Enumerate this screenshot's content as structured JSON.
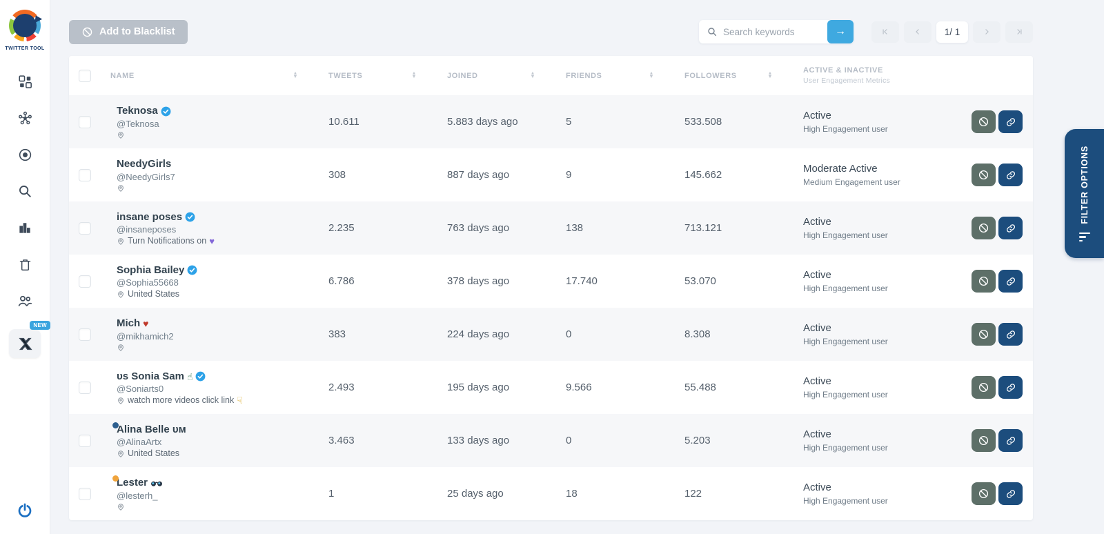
{
  "brand": {
    "title": "TWITTER TOOL"
  },
  "sidebar": {
    "items": [
      {
        "icon": "dashboard-grid-icon"
      },
      {
        "icon": "network-hub-icon"
      },
      {
        "icon": "target-icon"
      },
      {
        "icon": "search-icon"
      },
      {
        "icon": "bar-chart-icon"
      },
      {
        "icon": "trash-icon"
      },
      {
        "icon": "users-icon"
      },
      {
        "icon": "x-twitter-icon",
        "badge": "NEW",
        "highlight": true
      }
    ],
    "power_icon": "power-icon"
  },
  "toolbar": {
    "add_to_blacklist_label": "Add to Blacklist",
    "search_placeholder": "Search keywords",
    "page_indicator": "1/ 1"
  },
  "filter_tab_label": "FILTER OPTIONS",
  "table": {
    "headers": {
      "name": "NAME",
      "tweets": "TWEETS",
      "joined": "JOINED",
      "friends": "FRIENDS",
      "followers": "FOLLOWERS",
      "active": "ACTIVE & INACTIVE",
      "active_sub": "User Engagement Metrics"
    },
    "rows": [
      {
        "name": "Teknosa",
        "verified": true,
        "name_emoji": null,
        "handle": "@Teknosa",
        "location": "",
        "location_emoji": null,
        "tweets": "10.611",
        "joined": "5.883 days ago",
        "friends": "5",
        "followers": "533.508",
        "status": "Active",
        "status_sub": "High Engagement user",
        "avatar_colors": [
          "#25262b",
          "#e8702a"
        ],
        "presence_dot": null
      },
      {
        "name": "NeedyGirls",
        "verified": false,
        "name_emoji": null,
        "handle": "@NeedyGirls7",
        "location": "",
        "location_emoji": null,
        "tweets": "308",
        "joined": "887 days ago",
        "friends": "9",
        "followers": "145.662",
        "status": "Moderate Active",
        "status_sub": "Medium Engagement user",
        "avatar_colors": [
          "#cdb49a",
          "#8a6f54"
        ],
        "presence_dot": null
      },
      {
        "name": "insane poses",
        "verified": true,
        "name_emoji": null,
        "handle": "@insaneposes",
        "location": "Turn Notifications on",
        "location_emoji": "purple-heart",
        "tweets": "2.235",
        "joined": "763 days ago",
        "friends": "138",
        "followers": "713.121",
        "status": "Active",
        "status_sub": "High Engagement user",
        "avatar_colors": [
          "#3a3f4a",
          "#9aa0ab"
        ],
        "presence_dot": null
      },
      {
        "name": "Sophia Bailey",
        "verified": true,
        "name_emoji": null,
        "handle": "@Sophia55668",
        "location": "United States",
        "location_emoji": null,
        "tweets": "6.786",
        "joined": "378 days ago",
        "friends": "17.740",
        "followers": "53.070",
        "status": "Active",
        "status_sub": "High Engagement user",
        "avatar_colors": [
          "#e7cdb7",
          "#b98d6f"
        ],
        "presence_dot": null
      },
      {
        "name": "Mich",
        "verified": false,
        "name_emoji": "kiss-mark",
        "handle": "@mikhamich2",
        "location": "",
        "location_emoji": null,
        "tweets": "383",
        "joined": "224 days ago",
        "friends": "0",
        "followers": "8.308",
        "status": "Active",
        "status_sub": "High Engagement user",
        "avatar_colors": [
          "#7b7f55",
          "#3f4232"
        ],
        "presence_dot": null
      },
      {
        "name": "ᴜs Sonia Sam",
        "verified": true,
        "name_emoji": "point-up-hand",
        "handle": "@Soniarts0",
        "location": "watch more videos click link",
        "location_emoji": "point-down-hand",
        "tweets": "2.493",
        "joined": "195 days ago",
        "friends": "9.566",
        "followers": "55.488",
        "status": "Active",
        "status_sub": "High Engagement user",
        "avatar_colors": [
          "#7a2d34",
          "#27466b"
        ],
        "presence_dot": null
      },
      {
        "name": "Alina Belle ᴜᴍ",
        "verified": false,
        "name_emoji": null,
        "handle": "@AlinaArtx",
        "location": "United States",
        "location_emoji": null,
        "tweets": "3.463",
        "joined": "133 days ago",
        "friends": "0",
        "followers": "5.203",
        "status": "Active",
        "status_sub": "High Engagement user",
        "avatar_colors": [
          "#20242b",
          "#d8c0b0"
        ],
        "presence_dot": "#2d5f8f"
      },
      {
        "name": "Lester",
        "verified": false,
        "name_emoji": "sunglasses",
        "handle": "@lesterh_",
        "location": "",
        "location_emoji": null,
        "tweets": "1",
        "joined": "25 days ago",
        "friends": "18",
        "followers": "122",
        "status": "Active",
        "status_sub": "High Engagement user",
        "avatar_colors": [
          "#d6b073",
          "#9b7b4e"
        ],
        "presence_dot": "#f0a43c"
      }
    ]
  },
  "colors": {
    "accent_blue": "#3fa9e0",
    "navy": "#1c4d7d",
    "ban_green_gray": "#5d6f68",
    "verified_blue": "#2da2e8",
    "row_stripe": "#f6f7f9"
  }
}
